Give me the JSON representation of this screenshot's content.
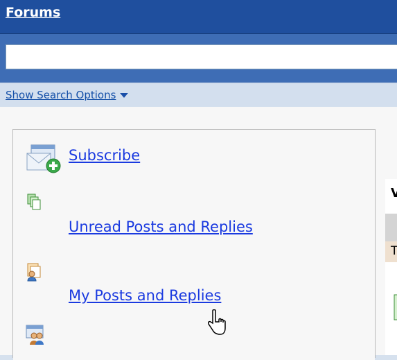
{
  "header": {
    "title": "Forums"
  },
  "search": {
    "value": "",
    "placeholder": ""
  },
  "options": {
    "label": "Show Search Options"
  },
  "panel": {
    "items": [
      {
        "label": "Subscribe",
        "icon": "subscribe-envelope-icon"
      },
      {
        "label": "Unread Posts and Replies",
        "icon": "unread-posts-icon"
      },
      {
        "label": "My Posts and Replies",
        "icon": "my-posts-icon"
      },
      {
        "label": "",
        "icon": "people-icon"
      }
    ]
  },
  "right_fragment": {
    "top_letter": "V",
    "mid_letter": "T"
  }
}
